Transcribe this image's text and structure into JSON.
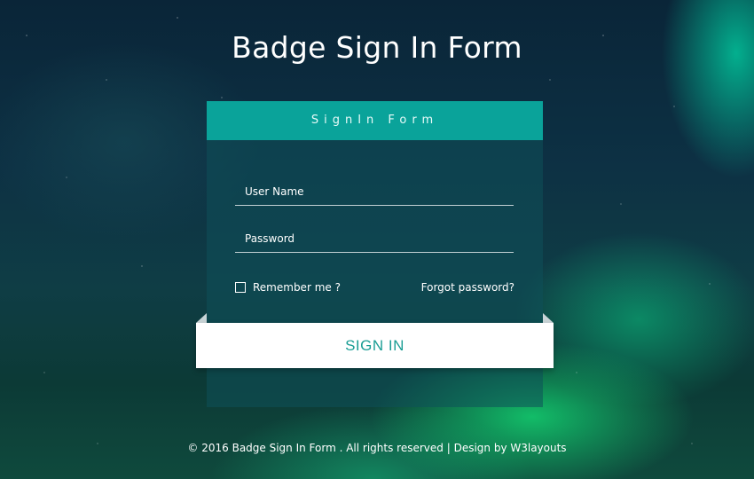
{
  "page": {
    "title": "Badge Sign In Form"
  },
  "form": {
    "header": "SignIn Form",
    "username": {
      "placeholder": "User Name",
      "value": ""
    },
    "password": {
      "placeholder": "Password",
      "value": ""
    },
    "remember_label": "Remember me ?",
    "remember_checked": false,
    "forgot_label": "Forgot password?",
    "submit_label": "SIGN IN"
  },
  "footer": {
    "text": "© 2016 Badge Sign In Form . All rights reserved | Design by ",
    "link_label": "W3layouts"
  },
  "colors": {
    "accent": "#0aa39a",
    "button_text": "#1a9d94",
    "button_bg": "#ffffff"
  },
  "icons": {
    "checkbox": "checkbox-empty-icon"
  }
}
